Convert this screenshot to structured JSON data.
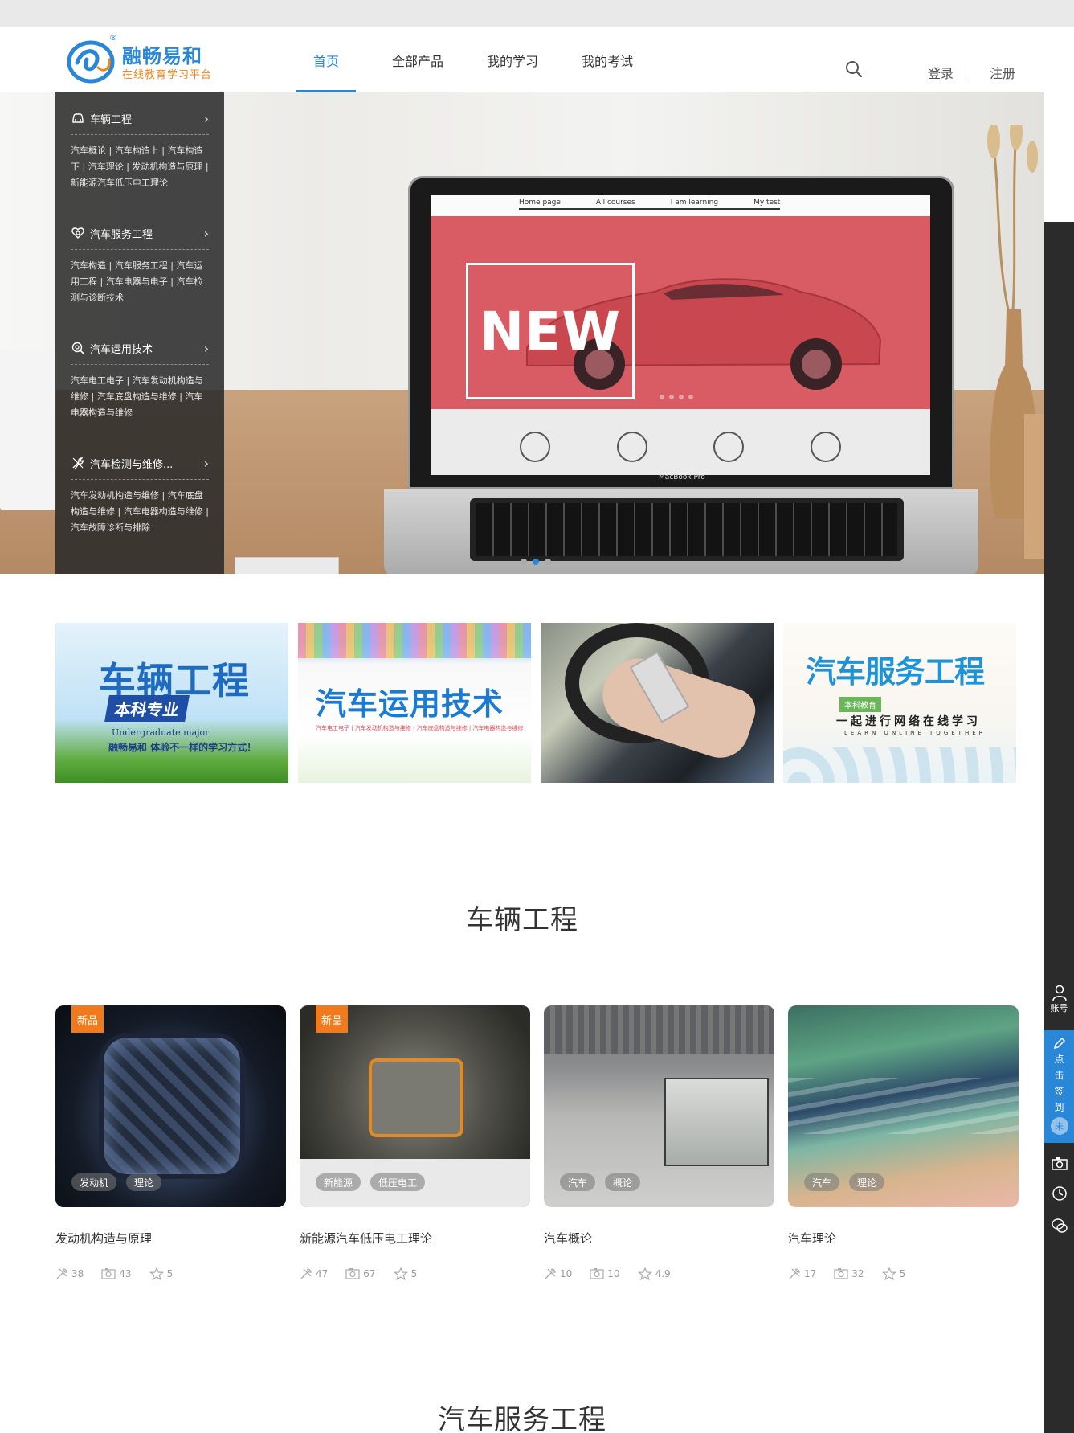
{
  "logo": {
    "name": "融畅易和",
    "tagline": "在线教育学习平台",
    "registered": "®"
  },
  "nav": {
    "items": [
      "首页",
      "全部产品",
      "我的学习",
      "我的考试"
    ],
    "active_index": 0
  },
  "auth": {
    "login": "登录",
    "register": "注册"
  },
  "banner": {
    "screen_nav": [
      "Home page",
      "All courses",
      "I am learning",
      "My test"
    ],
    "screen_headline": "NEW",
    "laptop_brand": "MacBook Pro",
    "dots": 3,
    "active_dot": 1
  },
  "categories": [
    {
      "title": "车辆工程",
      "icon": "car-icon",
      "desc": "汽车概论 | 汽车构造上 | 汽车构造下 | 汽车理论 | 发动机构造与原理 | 新能源汽车低压电工理论"
    },
    {
      "title": "汽车服务工程",
      "icon": "heart-service-icon",
      "desc": "汽车构造 | 汽车服务工程 | 汽车运用工程 | 汽车电器与电子 | 汽车检测与诊断技术"
    },
    {
      "title": "汽车运用技术",
      "icon": "gear-search-icon",
      "desc": "汽车电工电子 | 汽车发动机构造与维修 | 汽车底盘构造与维修 | 汽车电器构造与维修"
    },
    {
      "title": "汽车检测与维修...",
      "icon": "wrench-icon",
      "desc": "汽车发动机构造与维修 | 汽车底盘构造与维修 | 汽车电器构造与维修 | 汽车故障诊断与排除"
    }
  ],
  "promos": {
    "p1": {
      "title_a": "车辆",
      "title_b": "工程",
      "subtitle": "本科专业",
      "english": "Undergraduate major",
      "slogan": "融畅易和  体验不一样的学习方式！"
    },
    "p2": {
      "title": "汽车运用技术",
      "subtitle": "汽车电工电子 | 汽车发动机构造与维修 | 汽车底盘构造与维修 | 汽车电器构造与维修"
    },
    "p4": {
      "title": "汽车服务工程",
      "badge": "本科教育",
      "slogan": "一起进行网络在线学习",
      "english": "LEARN ONLINE TOGETHER"
    }
  },
  "sections": {
    "vehicle": "车辆工程",
    "service": "汽车服务工程"
  },
  "courses": [
    {
      "name": "发动机构造与原理",
      "badge": "新品",
      "tags": [
        "发动机",
        "理论"
      ],
      "learners": "38",
      "reviews": "43",
      "rating": "5"
    },
    {
      "name": "新能源汽车低压电工理论",
      "badge": "新品",
      "tags": [
        "新能源",
        "低压电工"
      ],
      "learners": "47",
      "reviews": "67",
      "rating": "5"
    },
    {
      "name": "汽车概论",
      "badge": "",
      "tags": [
        "汽车",
        "概论"
      ],
      "learners": "10",
      "reviews": "10",
      "rating": "4.9"
    },
    {
      "name": "汽车理论",
      "badge": "",
      "tags": [
        "汽车",
        "理论"
      ],
      "learners": "17",
      "reviews": "32",
      "rating": "5"
    }
  ],
  "sidebar": {
    "account": "账号",
    "sign_in_chars": [
      "点",
      "击",
      "签",
      "到"
    ],
    "sign_status": "未"
  },
  "colors": {
    "brand_blue": "#2a86d6",
    "badge_orange": "#f07a1c",
    "sidebar_dark": "#2b2b2b"
  }
}
